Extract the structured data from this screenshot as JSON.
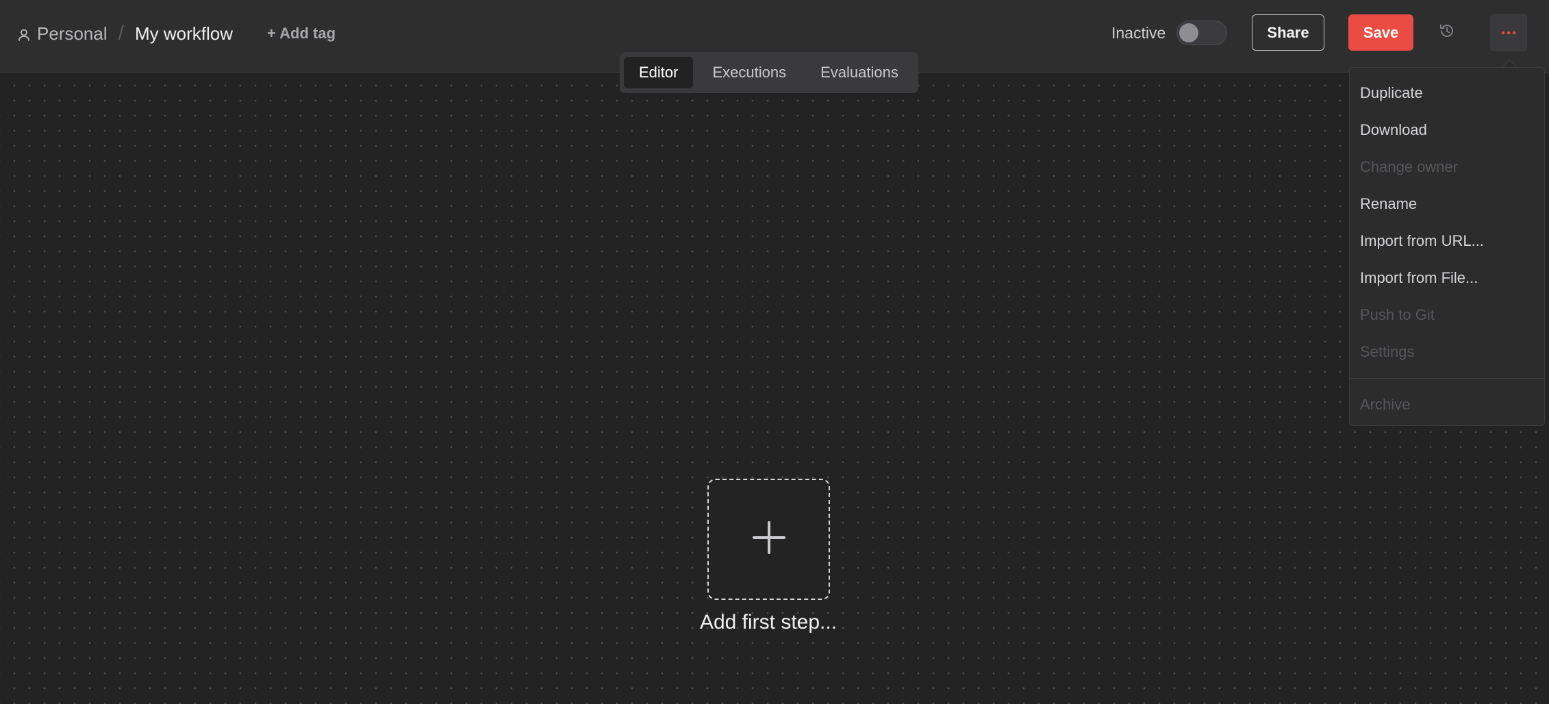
{
  "header": {
    "project": "Personal",
    "separator": "/",
    "workflow_name": "My workflow",
    "add_tag": "+ Add tag",
    "active_label": "Inactive",
    "active_toggle_on": false,
    "share_label": "Share",
    "save_label": "Save",
    "more_icon": "ellipsis-icon",
    "history_icon": "history-icon"
  },
  "tabs": [
    {
      "label": "Editor",
      "active": true
    },
    {
      "label": "Executions",
      "active": false
    },
    {
      "label": "Evaluations",
      "active": false
    }
  ],
  "canvas": {
    "add_first_step": "Add first step..."
  },
  "menu": {
    "items": [
      {
        "label": "Duplicate",
        "disabled": false
      },
      {
        "label": "Download",
        "disabled": false
      },
      {
        "label": "Change owner",
        "disabled": true
      },
      {
        "label": "Rename",
        "disabled": false
      },
      {
        "label": "Import from URL...",
        "disabled": false
      },
      {
        "label": "Import from File...",
        "disabled": false
      },
      {
        "label": "Push to Git",
        "disabled": true
      },
      {
        "label": "Settings",
        "disabled": true
      },
      {
        "label": "Archive",
        "disabled": true
      }
    ]
  },
  "colors": {
    "accent": "#ea4b42",
    "header_bg": "#2e2e2f",
    "canvas_bg": "#232323"
  }
}
